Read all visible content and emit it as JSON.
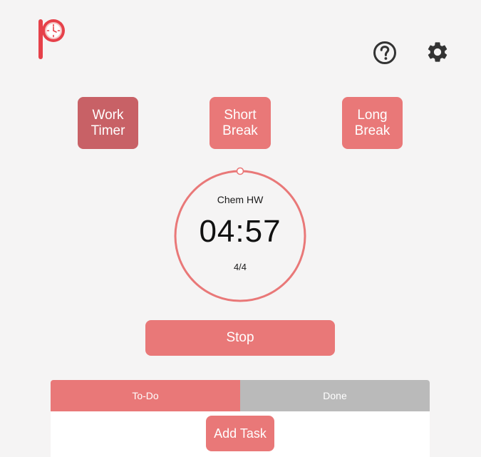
{
  "header": {
    "logo_icon": "pomodoro-clock-logo-icon",
    "help_icon": "question-circle-icon",
    "settings_icon": "gear-icon"
  },
  "modes": [
    {
      "line1": "Work",
      "line2": "Timer",
      "active": true
    },
    {
      "line1": "Short",
      "line2": "Break",
      "active": false
    },
    {
      "line1": "Long",
      "line2": "Break",
      "active": false
    }
  ],
  "timer": {
    "task_name": "Chem HW",
    "time": "04:57",
    "count": "4/4",
    "progress": 0.0
  },
  "controls": {
    "stop_label": "Stop"
  },
  "tasks": {
    "tabs": [
      {
        "label": "To-Do",
        "active": true
      },
      {
        "label": "Done",
        "active": false
      }
    ],
    "add_task_label": "Add Task"
  },
  "colors": {
    "accent": "#e97878",
    "accent_active": "#c86166",
    "inactive_tab": "#bababa",
    "background": "#f5f4f4",
    "icon_dark": "#333333"
  }
}
